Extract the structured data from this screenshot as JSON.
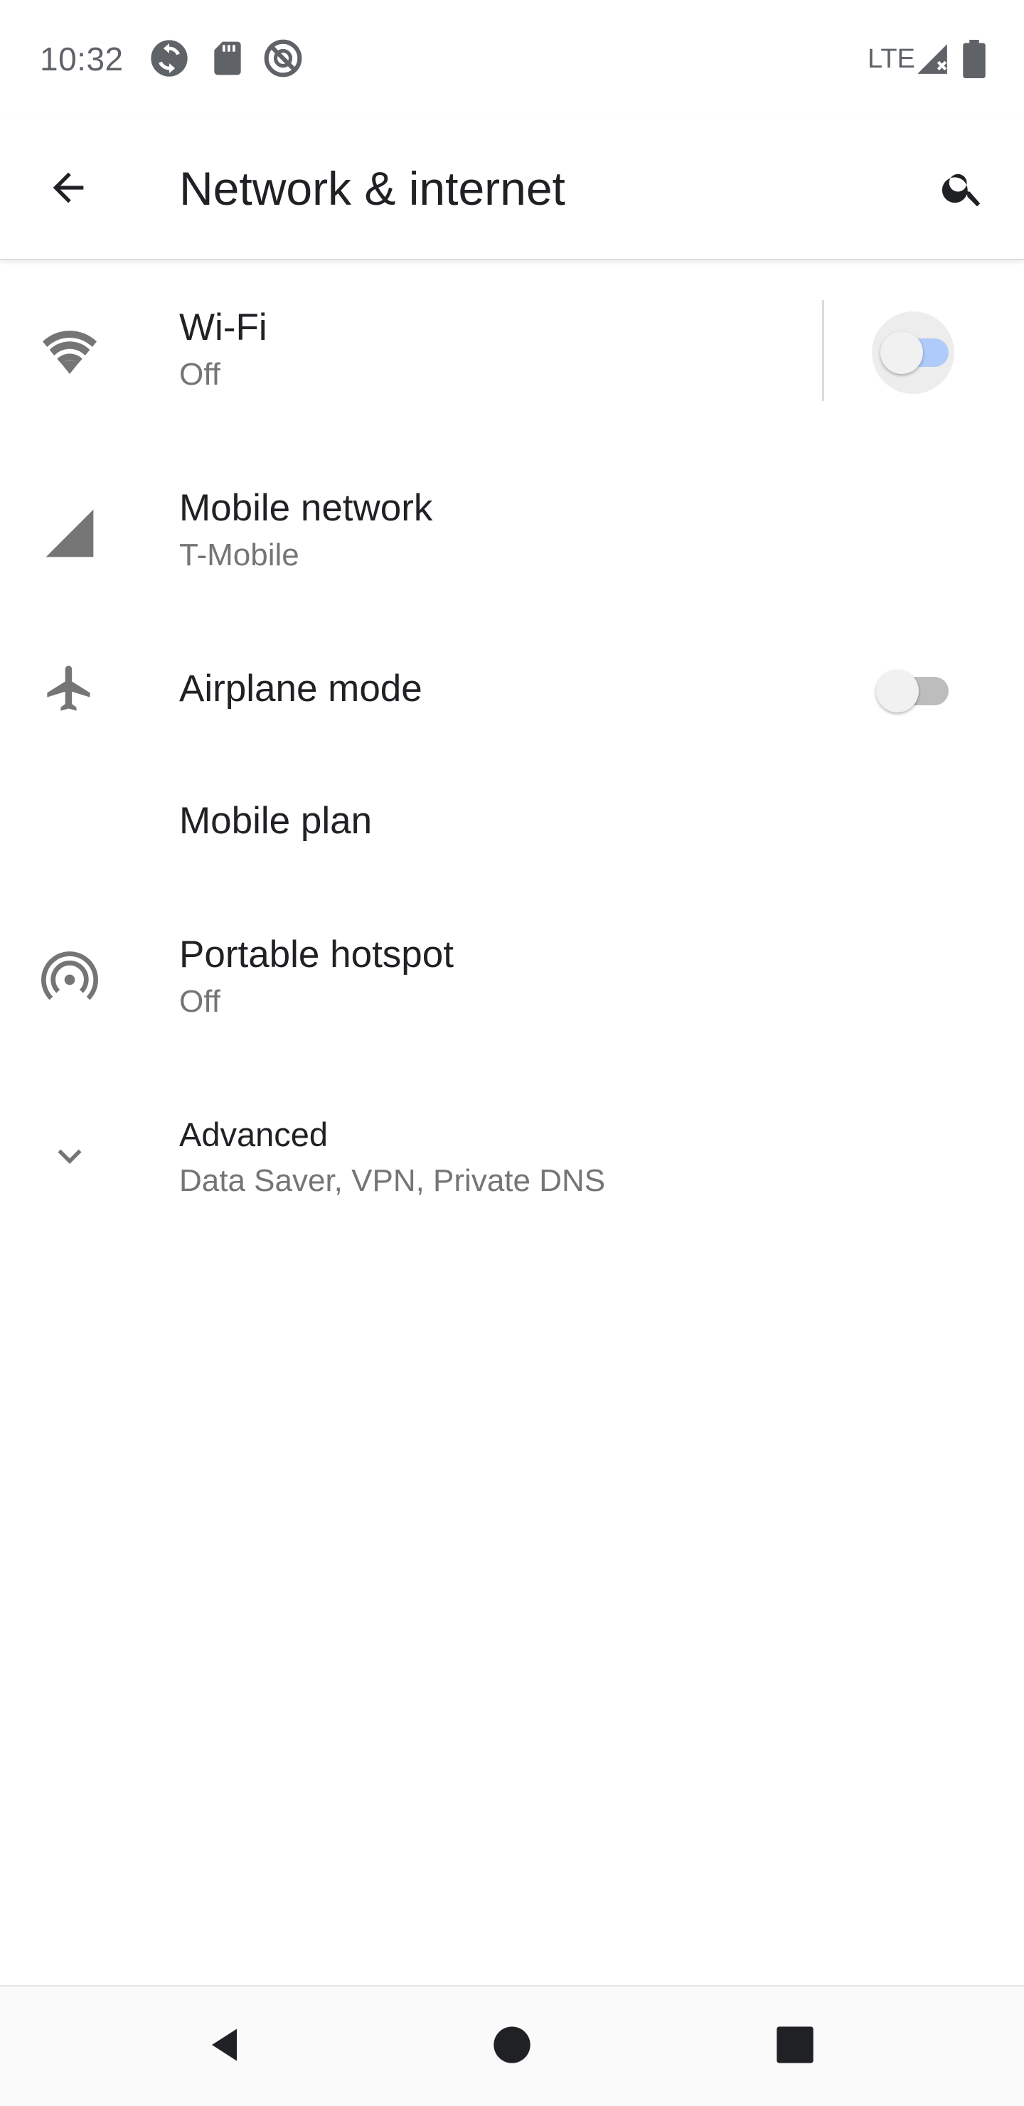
{
  "status_bar": {
    "time": "10:32",
    "network_label": "LTE",
    "icons": [
      "sync-icon",
      "sd-card-icon",
      "do-not-disturb-icon",
      "cell-signal-icon",
      "battery-icon"
    ]
  },
  "app_bar": {
    "title": "Network & internet",
    "back_icon": "arrow-back-icon",
    "search_icon": "search-icon"
  },
  "items": [
    {
      "title": "Wi-Fi",
      "summary": "Off",
      "icon": "wifi-icon",
      "switch": true,
      "switch_on": false
    },
    {
      "title": "Mobile network",
      "summary": "T-Mobile",
      "icon": "cell-signal-icon"
    },
    {
      "title": "Airplane mode",
      "summary": "",
      "icon": "airplane-icon",
      "switch": true,
      "switch_on": false
    },
    {
      "title": "Mobile plan",
      "summary": ""
    },
    {
      "title": "Portable hotspot",
      "summary": "Off",
      "icon": "hotspot-icon"
    },
    {
      "title": "Advanced",
      "summary": "Data Saver, VPN, Private DNS",
      "icon": "chevron-down-icon"
    }
  ],
  "nav_bar": {
    "buttons": [
      "back-triangle-icon",
      "home-circle-icon",
      "recents-square-icon"
    ]
  },
  "colors": {
    "accent_track": "#aecbfa",
    "icon_gray": "#757575",
    "text_primary": "#202124",
    "text_secondary": "#757575"
  }
}
